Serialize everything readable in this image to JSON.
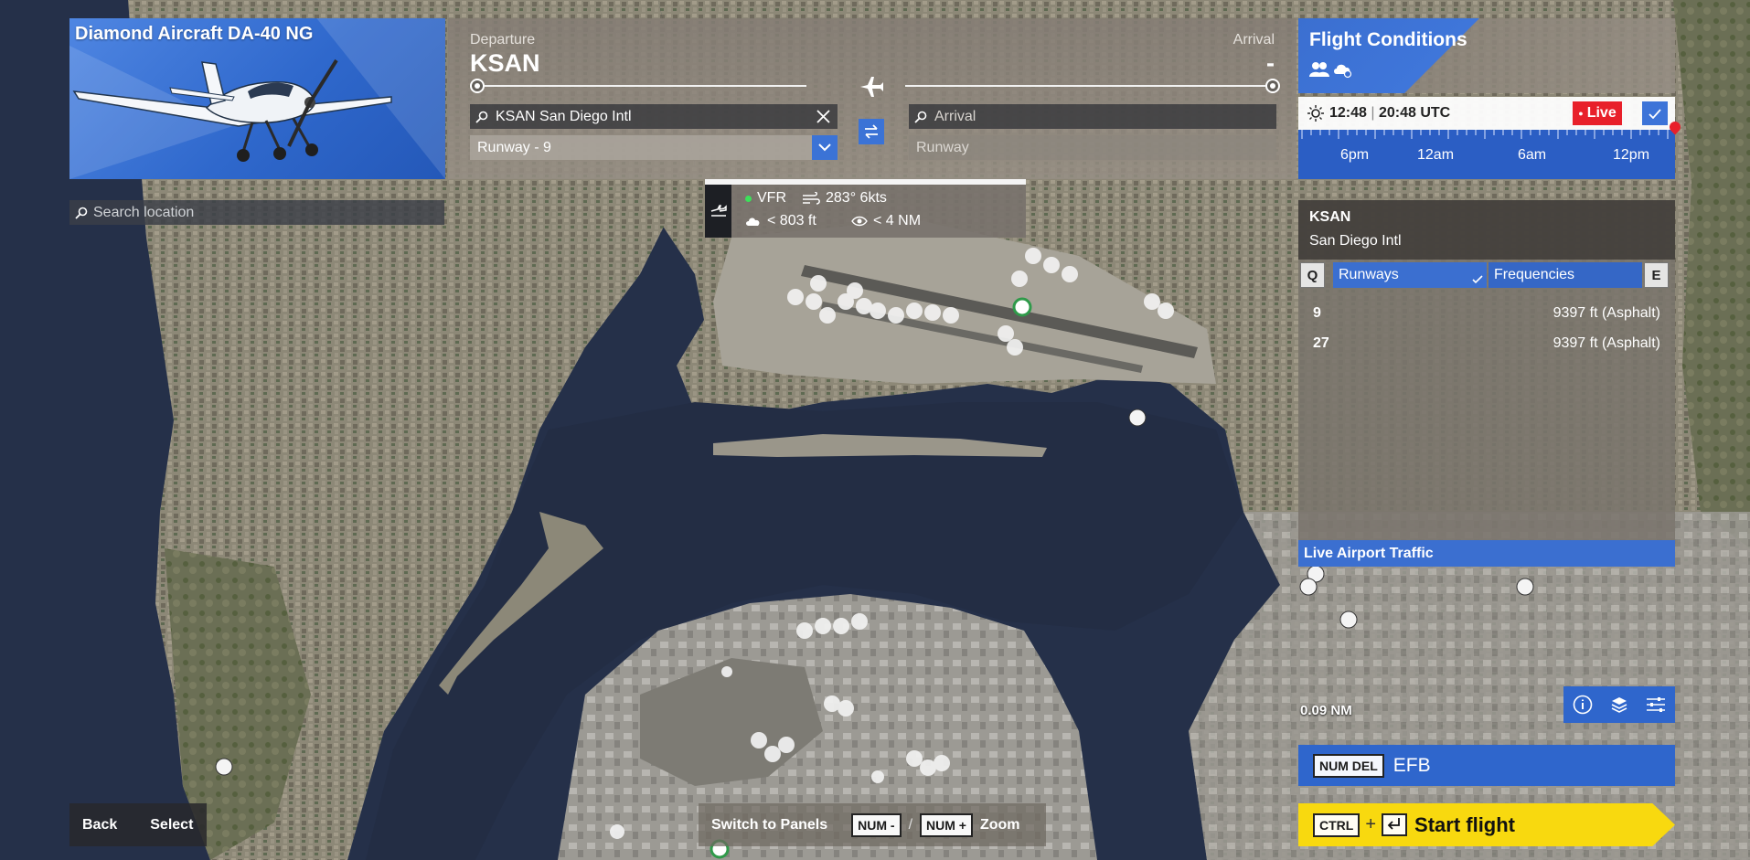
{
  "aircraft": {
    "name": "Diamond Aircraft DA-40 NG"
  },
  "search": {
    "placeholder": "Search location"
  },
  "route": {
    "departure_label": "Departure",
    "departure_code": "KSAN",
    "arrival_label": "Arrival",
    "arrival_code": "-",
    "departure_search_value": "KSAN San Diego Intl",
    "arrival_search_placeholder": "Arrival",
    "departure_runway": "Runway - 9",
    "arrival_runway": "Runway"
  },
  "weather_popup": {
    "category": "VFR",
    "wind": "283° 6kts",
    "ceiling": "< 803 ft",
    "visibility": "< 4 NM"
  },
  "flight_conditions": {
    "title": "Flight Conditions",
    "time": "12:48",
    "time_utc": "20:48 UTC",
    "live_label": "Live",
    "timeline": [
      "6pm",
      "12am",
      "6am",
      "12pm"
    ]
  },
  "airport": {
    "code": "KSAN",
    "name": "San Diego Intl",
    "tab_key_left": "Q",
    "tab_key_right": "E",
    "tabs": [
      "Runways",
      "Frequencies"
    ],
    "runways": [
      {
        "id": "9",
        "length": "9397 ft (Asphalt)"
      },
      {
        "id": "27",
        "length": "9397 ft (Asphalt)"
      }
    ],
    "live_traffic_label": "Live Airport Traffic"
  },
  "map": {
    "scale": "0.09 NM"
  },
  "efb": {
    "key": "NUM DEL",
    "label": "EFB"
  },
  "start": {
    "key": "CTRL",
    "plus": "+",
    "label": "Start flight"
  },
  "hints": {
    "back": "Back",
    "select": "Select",
    "switch": "Switch to Panels",
    "num_minus": "NUM -",
    "separator": "/",
    "num_plus": "NUM +",
    "zoom": "Zoom"
  },
  "colors": {
    "accent": "#2f66cc",
    "live": "#e8202a",
    "start": "#f8d90f"
  }
}
